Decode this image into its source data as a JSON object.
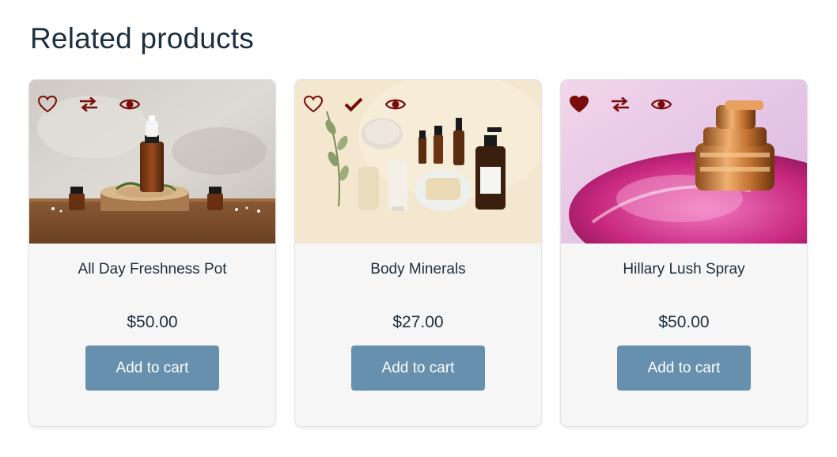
{
  "section": {
    "title": "Related products"
  },
  "colors": {
    "accent": "#7a0c0c",
    "button": "#6690ad",
    "text": "#1d2f3f",
    "card_bg": "#f6f6f6"
  },
  "products": [
    {
      "name": "All Day Freshness Pot",
      "price": "$50.00",
      "button_label": "Add to cart",
      "image": "essential-oil-bottles-photo",
      "actions": [
        "heart-outline-icon",
        "compare-icon",
        "eye-icon"
      ]
    },
    {
      "name": "Body Minerals",
      "price": "$27.00",
      "button_label": "Add to cart",
      "image": "skincare-flatlay-photo",
      "actions": [
        "heart-outline-icon",
        "check-icon",
        "eye-icon"
      ]
    },
    {
      "name": "Hillary Lush Spray",
      "price": "$50.00",
      "button_label": "Add to cart",
      "image": "pink-perfume-bottle-photo",
      "actions": [
        "heart-filled-icon",
        "compare-icon",
        "eye-icon"
      ]
    }
  ]
}
